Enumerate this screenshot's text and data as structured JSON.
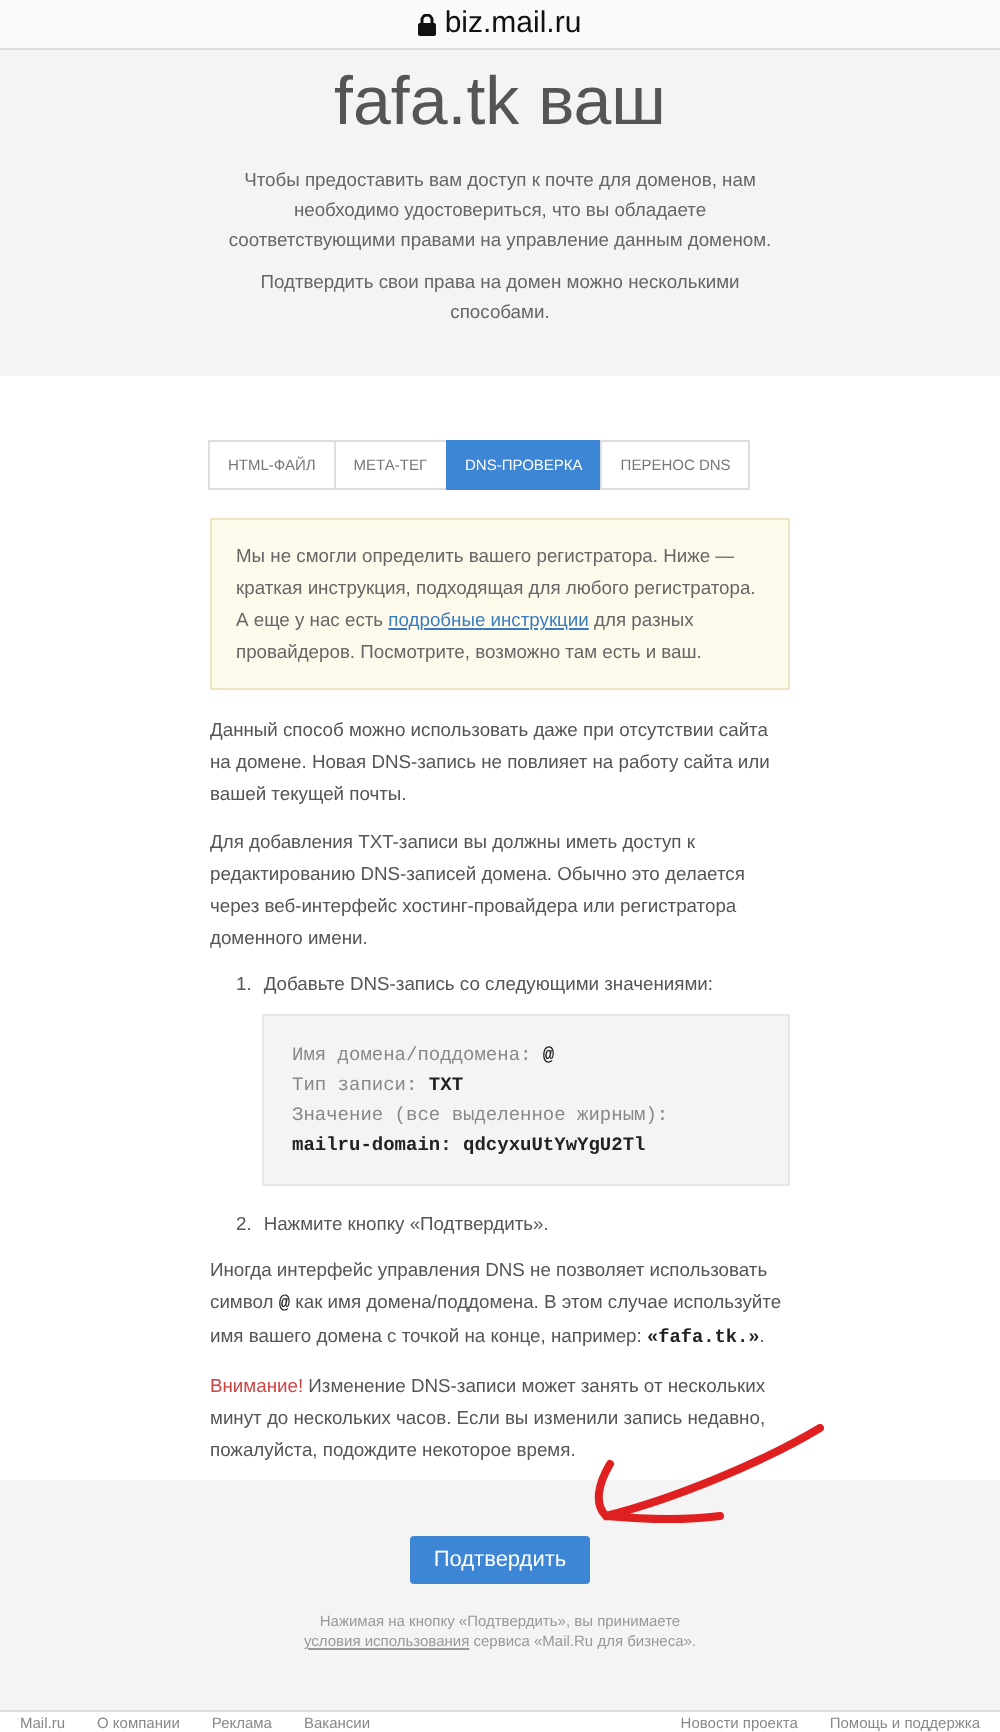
{
  "address_bar": {
    "url": "biz.mail.ru"
  },
  "header": {
    "title": "fafa.tk ваш",
    "paragraphs": [
      "Чтобы предоставить вам доступ к почте для доменов, нам необходимо удостовериться, что вы обладаете соответствующими правами на управление данным доменом.",
      "Подтвердить свои права на домен можно несколькими способами."
    ]
  },
  "tabs": [
    {
      "label": "HTML-ФАЙЛ",
      "selected": false
    },
    {
      "label": "МЕТА-ТЕГ",
      "selected": false
    },
    {
      "label": "DNS-ПРОВЕРКА",
      "selected": true
    },
    {
      "label": "ПЕРЕНОС DNS",
      "selected": false
    }
  ],
  "notice": {
    "before_link": "Мы не смогли определить вашего регистратора. Ниже — краткая инструкция, подходящая для любого регистратора. А еще у нас есть",
    "link": "подробные инструкции",
    "after_link": "для разных провайдеров. Посмотрите, возможно там есть и ваш."
  },
  "paragraphs": [
    "Данный способ можно использовать даже при отсутствии сайта на домене. Новая DNS-запись не повлияет на работу сайта или вашей текущей почты.",
    "Для добавления TXT-записи вы должны иметь доступ к редактированию DNS-записей домена. Обычно это делается через веб-интерфейс хостинг-провайдера или регистратора доменного имени."
  ],
  "steps": [
    {
      "number": "1.",
      "text": "Добавьте DNS-запись со следующими значениями:",
      "code_lines": [
        "Имя домена/поддомена: **@**",
        "Тип записи: **TXT**",
        "Значение (все выделенное жирным):",
        "**mailru-domain: qdcyxuUtYwYgU2Tl**"
      ]
    },
    {
      "number": "2.",
      "text": "Нажмите кнопку «Подтвердить»."
    }
  ],
  "note": "Иногда интерфейс управления DNS не позволяет использовать символ **@** как имя домена/поддомена. В этом случае используйте имя вашего домена с точкой на конце, например: **«fafa.tk.»**.",
  "warning": {
    "label": "Внимание!",
    "text": "Изменение DNS-записи может занять от нескольких минут до нескольких часов. Если вы изменили запись недавно, пожалуйста, подождите некоторое время."
  },
  "confirm_button": "Подтвердить",
  "terms": {
    "before_link": "Нажимая на кнопку «Подтвердить», вы принимаете",
    "link": "условия использования",
    "after_link": "сервиса «Mail.Ru для бизнеса»."
  },
  "footer": {
    "left_links": [
      "Mail.ru",
      "О компании",
      "Реклама",
      "Вакансии"
    ],
    "right_links": [
      "Новости проекта",
      "Помощь и поддержка"
    ]
  }
}
